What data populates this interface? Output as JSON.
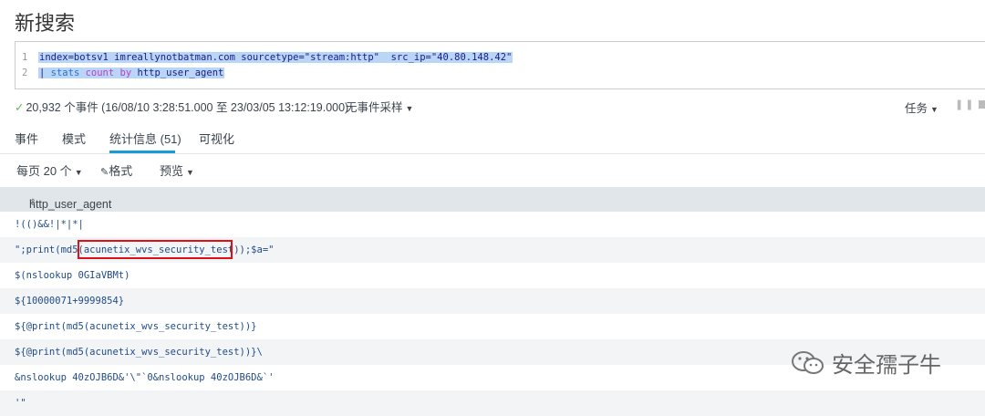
{
  "page": {
    "title": "新搜索"
  },
  "search": {
    "line1_no": "1",
    "line2_no": "2",
    "line1": "index=botsv1 imreallynotbatman.com sourcetype=\"stream:http\"  src_ip=\"40.80.148.42\"",
    "line2_pipe": "| ",
    "line2_cmd": "stats",
    "line2_sp1": " ",
    "line2_fn": "count",
    "line2_sp2": " ",
    "line2_by": "by",
    "line2_field": " http_user_agent"
  },
  "status": {
    "summary": "20,932 个事件 (16/08/10 3:28:51.000 至 23/03/05 13:12:19.000)",
    "sampling": "无事件采样",
    "tasks": "任务"
  },
  "tabs": [
    {
      "label": "事件"
    },
    {
      "label": "模式"
    },
    {
      "label": "统计信息 (51)"
    },
    {
      "label": "可视化"
    }
  ],
  "toolbar": {
    "per_page": "每页 20 个",
    "format": "格式",
    "preview": "预览"
  },
  "table": {
    "header": "http_user_agent",
    "rows": [
      "!(()&&!|*|*|",
      "\";print(md5(acunetix_wvs_security_test));$a=\"",
      "$(nslookup 0GIaVBMt)",
      "${10000071+9999854}",
      "${@print(md5(acunetix_wvs_security_test))}",
      "${@print(md5(acunetix_wvs_security_test))}\\",
      "&nslookup 40zOJB6D&'\\\"`0&nslookup 40zOJB6D&`'",
      "'\""
    ]
  },
  "watermark": {
    "text": "安全孺子牛"
  }
}
